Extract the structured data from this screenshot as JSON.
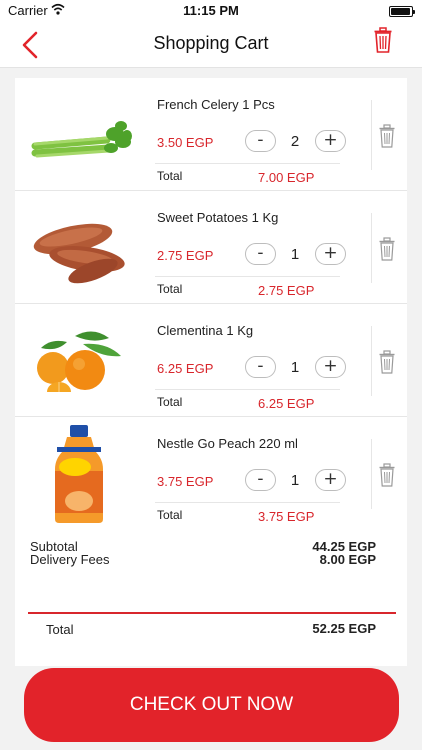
{
  "status": {
    "carrier": "Carrier",
    "time": "11:15 PM"
  },
  "nav": {
    "title": "Shopping Cart",
    "back_icon": "chevron-left-icon",
    "clear_icon": "trash-icon"
  },
  "colors": {
    "accent": "#e2232a",
    "price": "#d8262c"
  },
  "items": [
    {
      "name": "French Celery 1 Pcs",
      "price": "3.50 EGP",
      "qty": "2",
      "total_label": "Total",
      "total": "7.00 EGP",
      "minus": "-",
      "plus": "+",
      "image": "celery"
    },
    {
      "name": "Sweet Potatoes 1 Kg",
      "price": "2.75 EGP",
      "qty": "1",
      "total_label": "Total",
      "total": "2.75 EGP",
      "minus": "-",
      "plus": "+",
      "image": "sweet-potatoes"
    },
    {
      "name": "Clementina 1 Kg",
      "price": "6.25 EGP",
      "qty": "1",
      "total_label": "Total",
      "total": "6.25 EGP",
      "minus": "-",
      "plus": "+",
      "image": "clementines"
    },
    {
      "name": "Nestle Go Peach 220 ml",
      "price": "3.75 EGP",
      "qty": "1",
      "total_label": "Total",
      "total": "3.75 EGP",
      "minus": "-",
      "plus": "+",
      "image": "juice-bottle"
    }
  ],
  "summary": {
    "subtotal_label": "Subtotal",
    "subtotal": "44.25 EGP",
    "delivery_label": "Delivery Fees",
    "delivery": "8.00 EGP",
    "total_label": "Total",
    "total": "52.25 EGP"
  },
  "checkout_label": "CHECK OUT NOW"
}
